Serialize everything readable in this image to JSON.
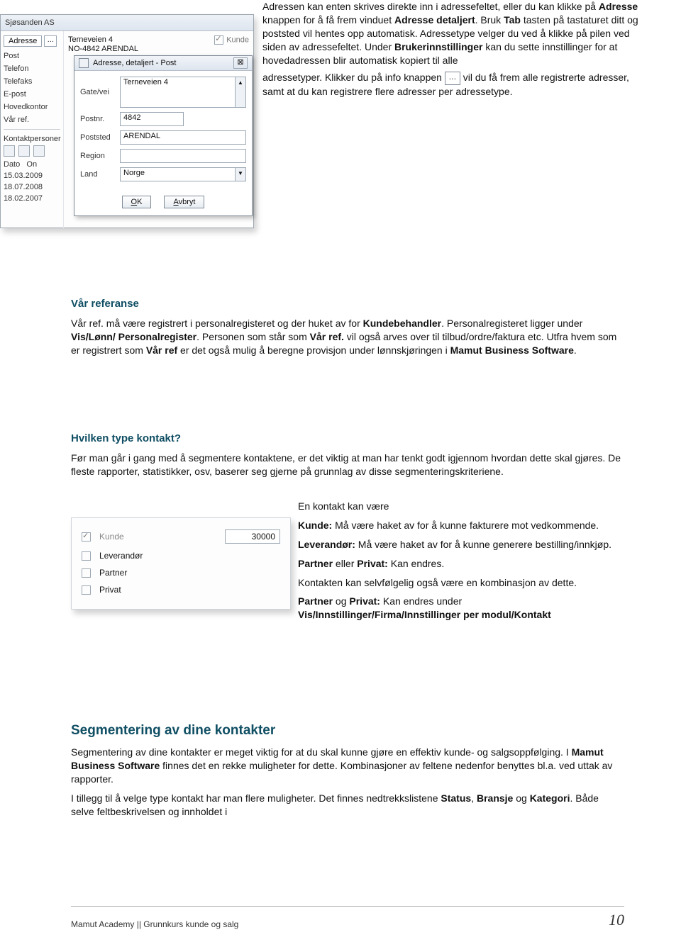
{
  "top": {
    "p1_before": "Adressen kan enten skrives direkte inn i adressefeltet, eller du kan klikke på ",
    "p1_b1": "Adresse",
    "p1_mid1": " knappen for å få frem vinduet ",
    "p1_b2": "Adresse detaljert",
    "p1_mid2": ". Bruk ",
    "p1_b3": "Tab",
    "p1_after": " tasten på tastaturet ditt og poststed vil hentes opp automatisk. Adressetype velger du ved å klikke på pilen ved siden av adressefeltet. Under ",
    "p1_b4": "Brukerinnstillinger",
    "p1_after2": " kan du sette innstillinger for at hovedadressen blir automatisk kopiert til alle",
    "p2_before": "adressetyper. Klikker du på info knappen ",
    "p2_after": " vil du få frem alle registrerte adresser, samt at du kan registrere flere adresser per adressetype."
  },
  "app": {
    "title": "Sjøsanden AS",
    "addrBtn": "Adresse",
    "leftItems": [
      "Post",
      "Telefon",
      "Telefaks",
      "E-post",
      "Hovedkontor",
      "Vår ref."
    ],
    "kontaktHeader": "Kontaktpersoner",
    "kolDato": "Dato",
    "kolOn": "On",
    "rows": [
      "15.03.2009",
      "18.07.2008",
      "18.02.2007"
    ],
    "addrLine1": "Terneveien 4",
    "addrLine2": "NO-4842 ARENDAL",
    "kundeLabel": "Kunde"
  },
  "dialog": {
    "title": "Adresse, detaljert - Post",
    "gate": {
      "label": "Gate/vei",
      "value": "Terneveien 4"
    },
    "postnr": {
      "label": "Postnr.",
      "value": "4842"
    },
    "poststed": {
      "label": "Poststed",
      "value": "ARENDAL"
    },
    "region": {
      "label": "Region",
      "value": ""
    },
    "land": {
      "label": "Land",
      "value": "Norge"
    },
    "ok": "OK",
    "avbryt": "Avbryt",
    "closeIcon": "⊠"
  },
  "ref": {
    "heading": "Vår referanse",
    "p_a": "Vår ref. må være registrert i personalregisteret og der huket av for ",
    "p_b1": "Kundebehandler",
    "p_b": ". Personalregisteret ligger under ",
    "p_b2": "Vis/Lønn/ Personalregister",
    "p_c": ". Personen som står som ",
    "p_b3": "Vår ref.",
    "p_d": " vil også arves over til tilbud/ordre/faktura etc. Utfra hvem som er registrert som ",
    "p_b4": "Vår ref",
    "p_e": " er det også mulig å beregne provisjon under lønnskjøringen i ",
    "p_b5": "Mamut Business Software",
    "p_f": "."
  },
  "type": {
    "heading": "Hvilken type kontakt?",
    "intro": "Før man går i gang med å segmentere kontaktene, er det viktig at man har tenkt godt igjennom hvordan dette skal gjøres. De fleste rapporter, statistikker, osv, baserer seg gjerne på grunnlag av disse segmenteringskriteriene.",
    "right1": "En kontakt kan være",
    "r_b1": "Kunde:",
    "r_t1": " Må være haket av for å kunne fakturere mot vedkommende.",
    "r_b2": "Leverandør:",
    "r_t2": " Må være haket av for å kunne generere bestilling/innkjøp.",
    "r_b3": "Partner",
    "r_mid3": " eller ",
    "r_b3b": "Privat:",
    "r_t3": " Kan endres.",
    "r_t4": "Kontakten kan selvfølgelig også være en kombinasjon av dette.",
    "r_b5": "Partner",
    "r_mid5": " og ",
    "r_b5b": "Privat:",
    "r_t5": " Kan endres under ",
    "r_b6": "Vis/Innstillinger/Firma/Innstillinger per modul/Kontakt",
    "card": {
      "kunde": "Kunde",
      "kundeNum": "30000",
      "lev": "Leverandør",
      "partner": "Partner",
      "priv": "Privat"
    }
  },
  "seg": {
    "heading": "Segmentering av dine kontakter",
    "p_a": "Segmentering av dine kontakter er meget viktig for at du skal kunne gjøre en effektiv kunde- og salgsoppfølging. I ",
    "p_b1": "Mamut Business Software",
    "p_b": " finnes det en rekke muligheter for dette. Kombinasjoner av feltene nedenfor benyttes bl.a. ved uttak av rapporter.",
    "p2_a": "I tillegg til å velge type kontakt har man flere muligheter. Det finnes nedtrekkslistene ",
    "p2_b1": "Status",
    "p2_mid1": ", ",
    "p2_b2": "Bransje",
    "p2_mid2": " og ",
    "p2_b3": "Kategori",
    "p2_b": ". Både selve feltbeskrivelsen og innholdet i"
  },
  "footer": {
    "left": "Mamut Academy || Grunnkurs kunde og salg",
    "page": "10"
  }
}
